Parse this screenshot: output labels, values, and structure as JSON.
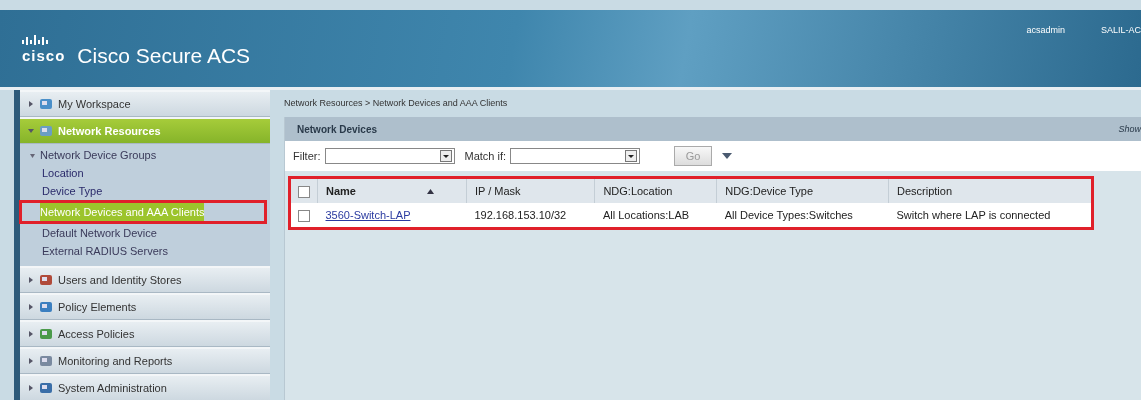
{
  "header": {
    "brand": "cisco",
    "product": "Cisco Secure ACS",
    "user": "acsadmin",
    "server": "SALIL-AC"
  },
  "sidebar": {
    "sections": [
      {
        "label": "My Workspace",
        "expanded": false,
        "selected": false
      },
      {
        "label": "Network Resources",
        "expanded": true,
        "selected": true,
        "children": [
          {
            "label": "Network Device Groups",
            "expanded": true,
            "selected": false,
            "annotated": false,
            "children": [
              {
                "label": "Location",
                "selected": false,
                "annotated": false
              },
              {
                "label": "Device Type",
                "selected": false,
                "annotated": false
              }
            ]
          },
          {
            "label": "Network Devices and AAA Clients",
            "selected": true,
            "annotated": true
          },
          {
            "label": "Default Network Device",
            "selected": false,
            "annotated": false
          },
          {
            "label": "External RADIUS Servers",
            "selected": false,
            "annotated": false
          }
        ]
      },
      {
        "label": "Users and Identity Stores",
        "expanded": false,
        "selected": false
      },
      {
        "label": "Policy Elements",
        "expanded": false,
        "selected": false
      },
      {
        "label": "Access Policies",
        "expanded": false,
        "selected": false
      },
      {
        "label": "Monitoring and Reports",
        "expanded": false,
        "selected": false
      },
      {
        "label": "System Administration",
        "expanded": false,
        "selected": false
      }
    ]
  },
  "breadcrumb": "Network Resources > Network Devices and AAA Clients",
  "panel": {
    "title": "Network Devices",
    "show_link": "Show",
    "filter": {
      "filter_label": "Filter:",
      "match_label": "Match if:",
      "go": "Go"
    },
    "table": {
      "annotated": true,
      "all_checked": false,
      "columns": [
        {
          "label": "Name",
          "sorted": true
        },
        {
          "label": "IP / Mask",
          "sorted": false
        },
        {
          "label": "NDG:Location",
          "sorted": false
        },
        {
          "label": "NDG:Device Type",
          "sorted": false
        },
        {
          "label": "Description",
          "sorted": false
        }
      ],
      "rows": [
        {
          "checked": false,
          "cells": [
            "3560-Switch-LAP",
            "192.168.153.10/32",
            "All Locations:LAB",
            "All Device Types:Switches",
            "Switch where LAP is connected"
          ]
        }
      ]
    }
  }
}
